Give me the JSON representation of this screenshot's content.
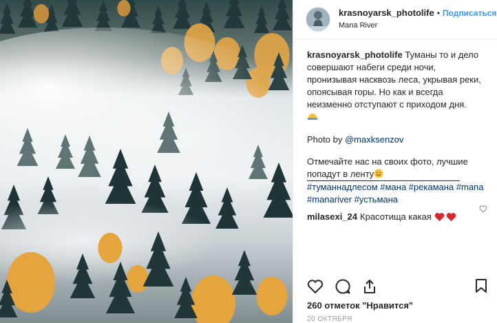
{
  "post": {
    "username": "krasnoyarsk_photolife",
    "separator": "•",
    "follow_label": "Подписаться",
    "location": "Mana River"
  },
  "caption": {
    "author": "krasnoyarsk_photolife",
    "text": "Туманы то и дело совершают набеги среди ночи, пронизывая насквозь леса, укрывая реки, опоясывая горы. Но как и всегда неизменно отступают с приходом дня.",
    "emoji_icon": "sunrise-icon",
    "photo_by_label": "Photo by",
    "photo_by_handle": "@maxksenzov",
    "invite_text": "Отмечайте нас на своих фото, лучшие попадут в ленту",
    "invite_emoji_icon": "smile-icon",
    "hashtags_line1": "#туманнадлесом #мана #рекамана #mana",
    "hashtags_line2": "#manariver #устьмана"
  },
  "comments": [
    {
      "user": "milasexi_24",
      "text": "Красотища какая",
      "emoji": [
        "heart-icon",
        "heart-icon"
      ]
    }
  ],
  "likes_text": "260 отметок \"Нравится\"",
  "date_text": "20 ОКТЯБРЯ",
  "colors": {
    "accent": "#3897f0",
    "link": "#003569",
    "heart_red": "#ed4956",
    "fog": "#e9edf0",
    "fir": "#1f3a3d",
    "autumn": "#e0a238"
  }
}
